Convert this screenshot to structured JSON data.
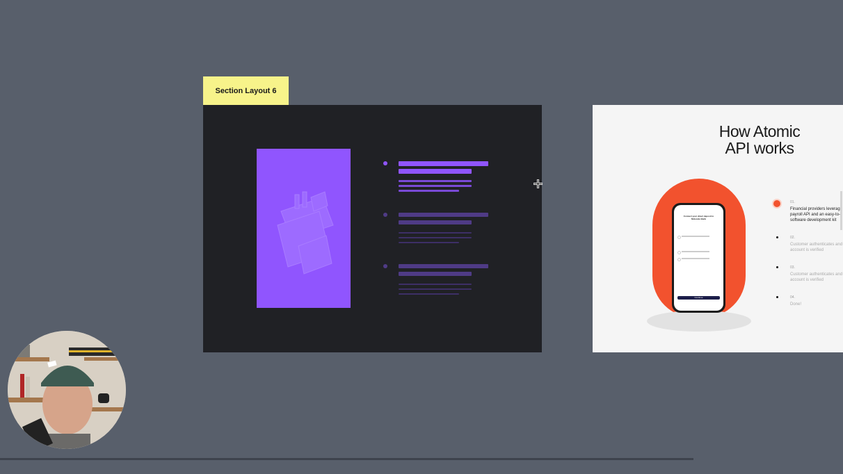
{
  "section_label": "Section Layout 6",
  "right_slide": {
    "title_line1": "How Atomic",
    "title_line2": "API works",
    "phone": {
      "heading_line1": "Connect your direct deposit to",
      "heading_line2": "Molecule Bank",
      "button_label": "Continue"
    },
    "steps": [
      {
        "number": "01.",
        "line1": "Financial providers leverage",
        "line2": "payroll API and an easy-to-i",
        "line3": "software development kit"
      },
      {
        "number": "02.",
        "line1": "Customer authenticates and",
        "line2": "account is verified"
      },
      {
        "number": "03.",
        "line1": "Customer authenticates and",
        "line2": "account is verified"
      },
      {
        "number": "04.",
        "line1": "Done!"
      }
    ]
  },
  "colors": {
    "background": "#585f6b",
    "label_bg": "#f7f38a",
    "dark_slide": "#202125",
    "accent_purple": "#9055fe",
    "accent_orange": "#f2522e"
  }
}
